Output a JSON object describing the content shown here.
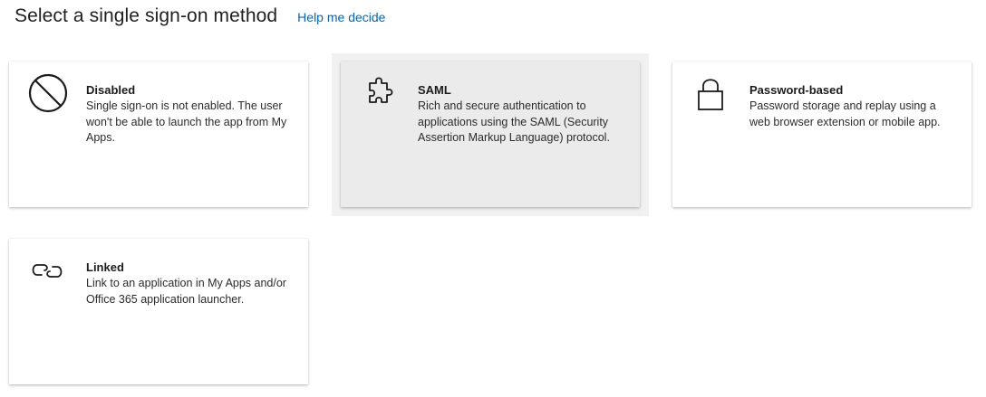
{
  "header": {
    "title": "Select a single sign-on method",
    "help_link": "Help me decide"
  },
  "cards": [
    {
      "icon": "disabled-icon",
      "title": "Disabled",
      "description": "Single sign-on is not enabled. The user won't be able to launch the app from My Apps."
    },
    {
      "icon": "puzzle-icon",
      "title": "SAML",
      "description": "Rich and secure authentication to applications using the SAML (Security Assertion Markup Language) protocol.",
      "selected": true
    },
    {
      "icon": "lock-icon",
      "title": "Password-based",
      "description": "Password storage and replay using a web browser extension or mobile app."
    },
    {
      "icon": "link-icon",
      "title": "Linked",
      "description": "Link to an application in My Apps and/or Office 365 application launcher."
    }
  ],
  "colors": {
    "link": "#0067b8",
    "selected_card_bg": "#ebebeb",
    "selected_halo_bg": "#f1f1f1"
  }
}
